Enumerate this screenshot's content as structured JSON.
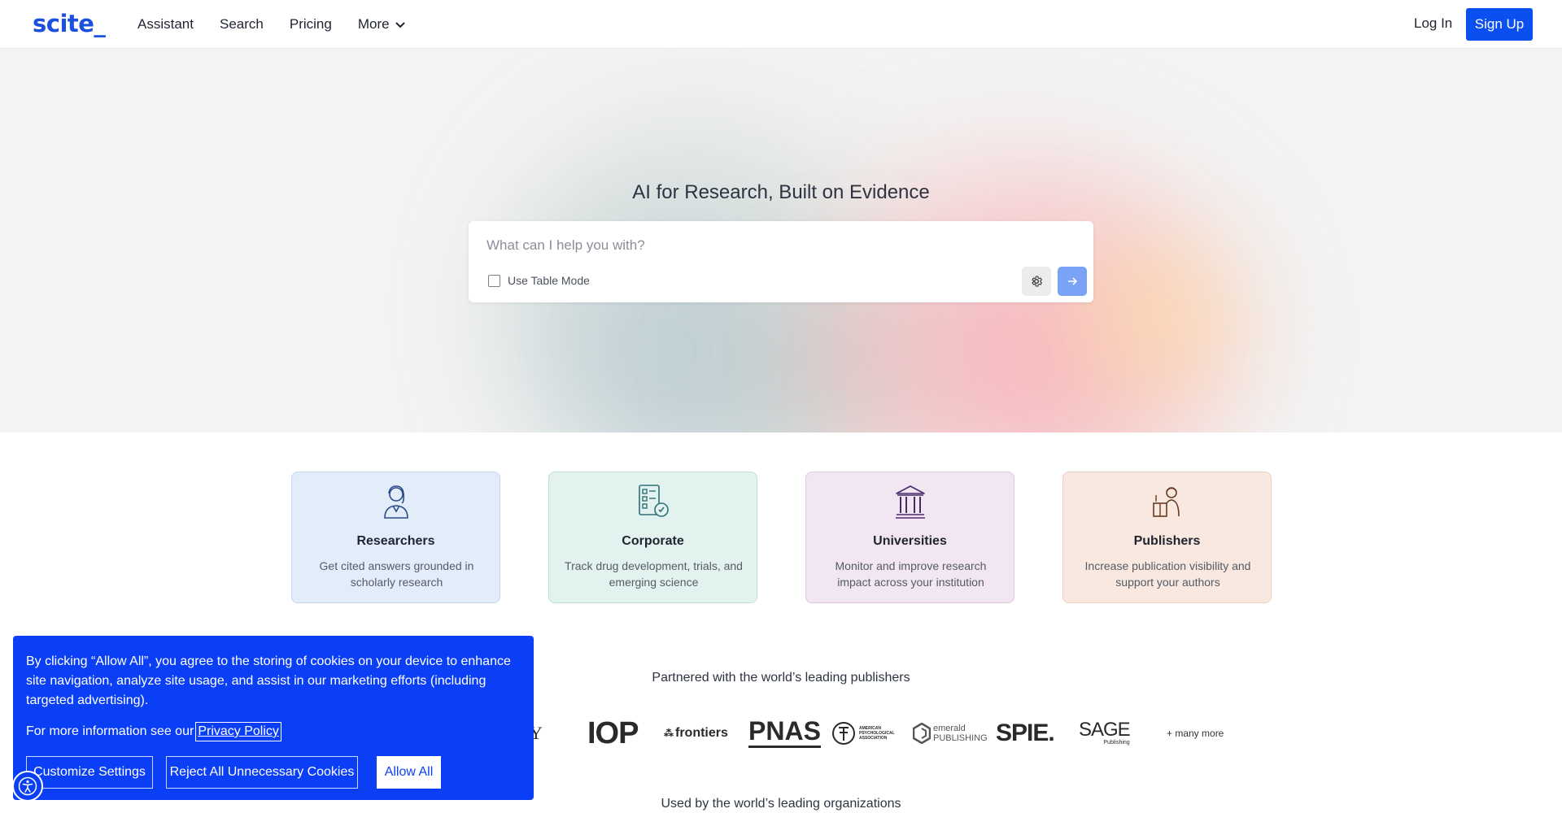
{
  "header": {
    "logo": "scite_",
    "nav": [
      "Assistant",
      "Search",
      "Pricing",
      "More"
    ],
    "login": "Log In",
    "signup": "Sign Up"
  },
  "hero": {
    "title": "AI for Research, Built on Evidence",
    "search_placeholder": "What can I help you with?",
    "table_mode_label": "Use Table Mode"
  },
  "cards": [
    {
      "title": "Researchers",
      "desc": "Get cited answers grounded in scholarly research",
      "icon": "researcher-icon",
      "bg": "#e3edf9",
      "border": "#c4d6ee",
      "accent": "#2c4a8a"
    },
    {
      "title": "Corporate",
      "desc": "Track drug development, trials, and emerging science",
      "icon": "corporate-document-icon",
      "bg": "#e2f2ef",
      "border": "#bfe0da",
      "accent": "#2f6f76"
    },
    {
      "title": "Universities",
      "desc": "Monitor and improve research impact across your institution",
      "icon": "university-building-icon",
      "bg": "#f1e6f2",
      "border": "#e0c8e2",
      "accent": "#4c2a6a"
    },
    {
      "title": "Publishers",
      "desc": "Increase publication visibility and support your authors",
      "icon": "publisher-icon",
      "bg": "#f8e8df",
      "border": "#ecd1c2",
      "accent": "#6a3a1e"
    }
  ],
  "partners": {
    "title": "Partnered with the world’s leading publishers",
    "logos": [
      "LEY",
      "IOP",
      "frontiers",
      "PNAS",
      "AMERICAN PSYCHOLOGICAL ASSOCIATION",
      "emerald PUBLISHING",
      "SPIE.",
      "SAGE",
      "Publishing",
      "+ many more"
    ]
  },
  "orgs_title": "Used by the world’s leading organizations",
  "cookie": {
    "text": "By clicking “Allow All”, you agree to the storing of cookies on your device to enhance site navigation, analyze site usage, and assist in our marketing efforts (including targeted advertising).",
    "more_prefix": "For more information see our",
    "privacy_link": "Privacy Policy",
    "buttons": [
      "Customize Settings",
      "Reject All Unnecessary Cookies",
      "Allow All"
    ]
  },
  "colors": {
    "brand": "#1a4fe0",
    "signup_bg": "#0b4ff0",
    "cookie_bg": "#0b3ff5"
  }
}
